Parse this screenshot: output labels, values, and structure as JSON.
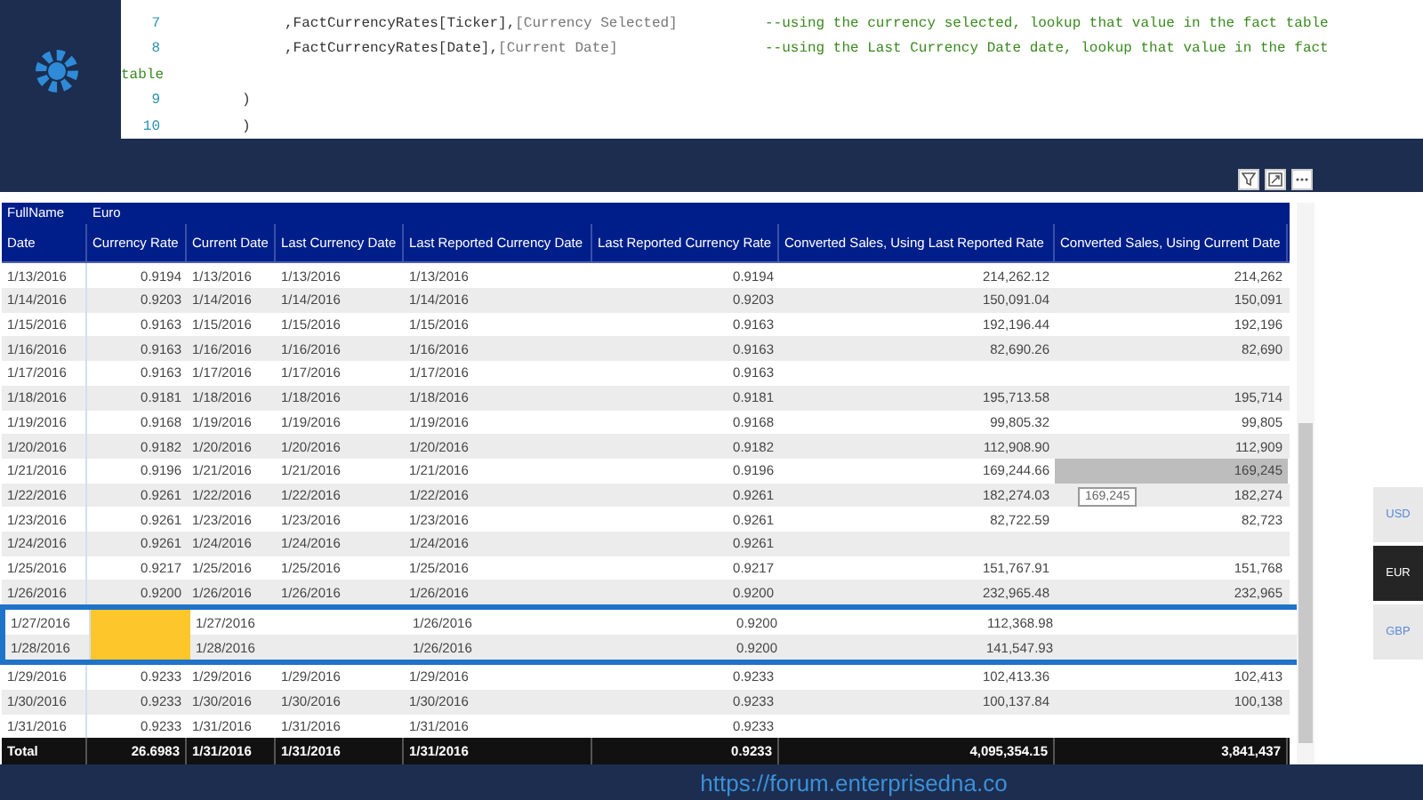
{
  "code_editor": {
    "lines": [
      {
        "number": "7",
        "indent": true,
        "segments": [
          {
            "kind": "code",
            "text": ",FactCurrencyRates[Ticker],"
          },
          {
            "kind": "param",
            "text": "[Currency Selected]"
          }
        ],
        "comment": "--using the currency selected, lookup that value in the fact table"
      },
      {
        "number": "8",
        "indent": true,
        "segments": [
          {
            "kind": "code",
            "text": ",FactCurrencyRates[Date],"
          },
          {
            "kind": "param",
            "text": "[Current Date]"
          }
        ],
        "comment": "--using the Last Currency Date date, lookup that value in the fact"
      },
      {
        "wrap": "table"
      },
      {
        "number": "9",
        "indent": false,
        "segments": [
          {
            "kind": "code",
            "text": ")"
          }
        ]
      },
      {
        "number": "10",
        "indent": false,
        "segments": [
          {
            "kind": "code",
            "text": ")"
          }
        ]
      }
    ]
  },
  "table": {
    "header": [
      "FullName",
      "Euro"
    ],
    "columns": [
      "Date",
      "Currency Rate",
      "Current Date",
      "Last Currency Date",
      "Last Reported Currency Date",
      "Last Reported Currency Rate",
      "Converted Sales, Using Last Reported Rate",
      "Converted Sales, Using Current Date"
    ],
    "rows": [
      {
        "cells": [
          "1/13/2016",
          "0.9194",
          "1/13/2016",
          "1/13/2016",
          "1/13/2016",
          "0.9194",
          "214,262.12",
          "214,262"
        ],
        "missing_rate": false,
        "outlined": false
      },
      {
        "cells": [
          "1/14/2016",
          "0.9203",
          "1/14/2016",
          "1/14/2016",
          "1/14/2016",
          "0.9203",
          "150,091.04",
          "150,091"
        ],
        "missing_rate": false,
        "outlined": false
      },
      {
        "cells": [
          "1/15/2016",
          "0.9163",
          "1/15/2016",
          "1/15/2016",
          "1/15/2016",
          "0.9163",
          "192,196.44",
          "192,196"
        ],
        "missing_rate": false,
        "outlined": false
      },
      {
        "cells": [
          "1/16/2016",
          "0.9163",
          "1/16/2016",
          "1/16/2016",
          "1/16/2016",
          "0.9163",
          "82,690.26",
          "82,690"
        ],
        "missing_rate": false,
        "outlined": false
      },
      {
        "cells": [
          "1/17/2016",
          "0.9163",
          "1/17/2016",
          "1/17/2016",
          "1/17/2016",
          "0.9163",
          null,
          null
        ],
        "missing_rate": false,
        "outlined": false
      },
      {
        "cells": [
          "1/18/2016",
          "0.9181",
          "1/18/2016",
          "1/18/2016",
          "1/18/2016",
          "0.9181",
          "195,713.58",
          "195,714"
        ],
        "missing_rate": false,
        "outlined": false
      },
      {
        "cells": [
          "1/19/2016",
          "0.9168",
          "1/19/2016",
          "1/19/2016",
          "1/19/2016",
          "0.9168",
          "99,805.32",
          "99,805"
        ],
        "missing_rate": false,
        "outlined": false
      },
      {
        "cells": [
          "1/20/2016",
          "0.9182",
          "1/20/2016",
          "1/20/2016",
          "1/20/2016",
          "0.9182",
          "112,908.90",
          "112,909"
        ],
        "missing_rate": false,
        "outlined": false
      },
      {
        "cells": [
          "1/21/2016",
          "0.9196",
          "1/21/2016",
          "1/21/2016",
          "1/21/2016",
          "0.9196",
          "169,244.66",
          "169,245"
        ],
        "missing_rate": false,
        "outlined": false,
        "hovered": true,
        "tooltip": "169,245"
      },
      {
        "cells": [
          "1/22/2016",
          "0.9261",
          "1/22/2016",
          "1/22/2016",
          "1/22/2016",
          "0.9261",
          "182,274.03",
          "182,274"
        ],
        "missing_rate": false,
        "outlined": false
      },
      {
        "cells": [
          "1/23/2016",
          "0.9261",
          "1/23/2016",
          "1/23/2016",
          "1/23/2016",
          "0.9261",
          "82,722.59",
          "82,723"
        ],
        "missing_rate": false,
        "outlined": false
      },
      {
        "cells": [
          "1/24/2016",
          "0.9261",
          "1/24/2016",
          "1/24/2016",
          "1/24/2016",
          "0.9261",
          null,
          null
        ],
        "missing_rate": false,
        "outlined": false
      },
      {
        "cells": [
          "1/25/2016",
          "0.9217",
          "1/25/2016",
          "1/25/2016",
          "1/25/2016",
          "0.9217",
          "151,767.91",
          "151,768"
        ],
        "missing_rate": false,
        "outlined": false
      },
      {
        "cells": [
          "1/26/2016",
          "0.9200",
          "1/26/2016",
          "1/26/2016",
          "1/26/2016",
          "0.9200",
          "232,965.48",
          "232,965"
        ],
        "missing_rate": false,
        "outlined": false
      },
      {
        "cells": [
          "1/27/2016",
          null,
          "1/27/2016",
          null,
          "1/26/2016",
          "0.9200",
          "112,368.98",
          null
        ],
        "missing_rate": true,
        "outlined": true
      },
      {
        "cells": [
          "1/28/2016",
          null,
          "1/28/2016",
          null,
          "1/26/2016",
          "0.9200",
          "141,547.93",
          null
        ],
        "missing_rate": true,
        "outlined": true
      },
      {
        "cells": [
          "1/29/2016",
          "0.9233",
          "1/29/2016",
          "1/29/2016",
          "1/29/2016",
          "0.9233",
          "102,413.36",
          "102,413"
        ],
        "missing_rate": false,
        "outlined": false
      },
      {
        "cells": [
          "1/30/2016",
          "0.9233",
          "1/30/2016",
          "1/30/2016",
          "1/30/2016",
          "0.9233",
          "100,137.84",
          "100,138"
        ],
        "missing_rate": false,
        "outlined": false
      },
      {
        "cells": [
          "1/31/2016",
          "0.9233",
          "1/31/2016",
          "1/31/2016",
          "1/31/2016",
          "0.9233",
          null,
          null
        ],
        "missing_rate": false,
        "outlined": false
      }
    ],
    "total": [
      "Total",
      "26.6983",
      "1/31/2016",
      "1/31/2016",
      "1/31/2016",
      "0.9233",
      "4,095,354.15",
      "3,841,437"
    ]
  },
  "slicer": [
    {
      "label": "USD",
      "selected": false
    },
    {
      "label": "EUR",
      "selected": true
    },
    {
      "label": "GBP",
      "selected": false
    }
  ],
  "footer": {
    "url": "https://forum.enterprisedna.co"
  }
}
